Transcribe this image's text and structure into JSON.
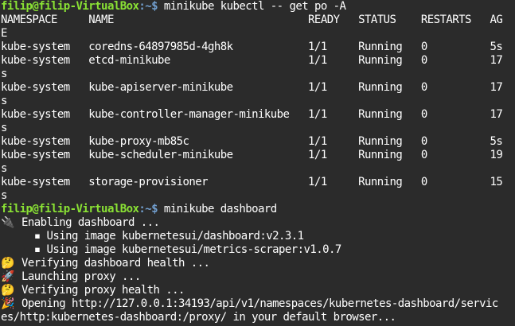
{
  "prompt": {
    "user_host": "filip@filip-VirtualBox",
    "path": ":~$",
    "command1": " minikube kubectl -- get po -A",
    "command2": " minikube dashboard"
  },
  "table_lines": [
    "NAMESPACE     NAME                               READY   STATUS    RESTARTS   AG",
    "E",
    "kube-system   coredns-64897985d-4gh8k            1/1     Running   0          5s",
    "kube-system   etcd-minikube                      1/1     Running   0          17",
    "s",
    "kube-system   kube-apiserver-minikube            1/1     Running   0          17",
    "s",
    "kube-system   kube-controller-manager-minikube   1/1     Running   0          17",
    "s",
    "kube-system   kube-proxy-mb85c                   1/1     Running   0          5s",
    "kube-system   kube-scheduler-minikube            1/1     Running   0          19",
    "s",
    "kube-system   storage-provisioner                1/1     Running   0          15",
    "s"
  ],
  "dashboard_lines": [
    {
      "icon": "🔌",
      "icon_name": "plug-icon",
      "text": "Enabling dashboard ..."
    },
    {
      "icon": "",
      "icon_name": "",
      "text": "  ▪ Using image kubernetesui/dashboard:v2.3.1"
    },
    {
      "icon": "",
      "icon_name": "",
      "text": "  ▪ Using image kubernetesui/metrics-scraper:v1.0.7"
    },
    {
      "icon": "🤔",
      "icon_name": "thinking-face-icon",
      "text": "Verifying dashboard health ..."
    },
    {
      "icon": "🚀",
      "icon_name": "rocket-icon",
      "text": "Launching proxy ..."
    },
    {
      "icon": "🤔",
      "icon_name": "thinking-face-icon",
      "text": "Verifying proxy health ..."
    },
    {
      "icon": "🎉",
      "icon_name": "party-popper-icon",
      "text": "Opening http://127.0.0.1:34193/api/v1/namespaces/kubernetes-dashboard/servic"
    }
  ],
  "wrap_last": "es/http:kubernetes-dashboard:/proxy/ in your default browser..."
}
